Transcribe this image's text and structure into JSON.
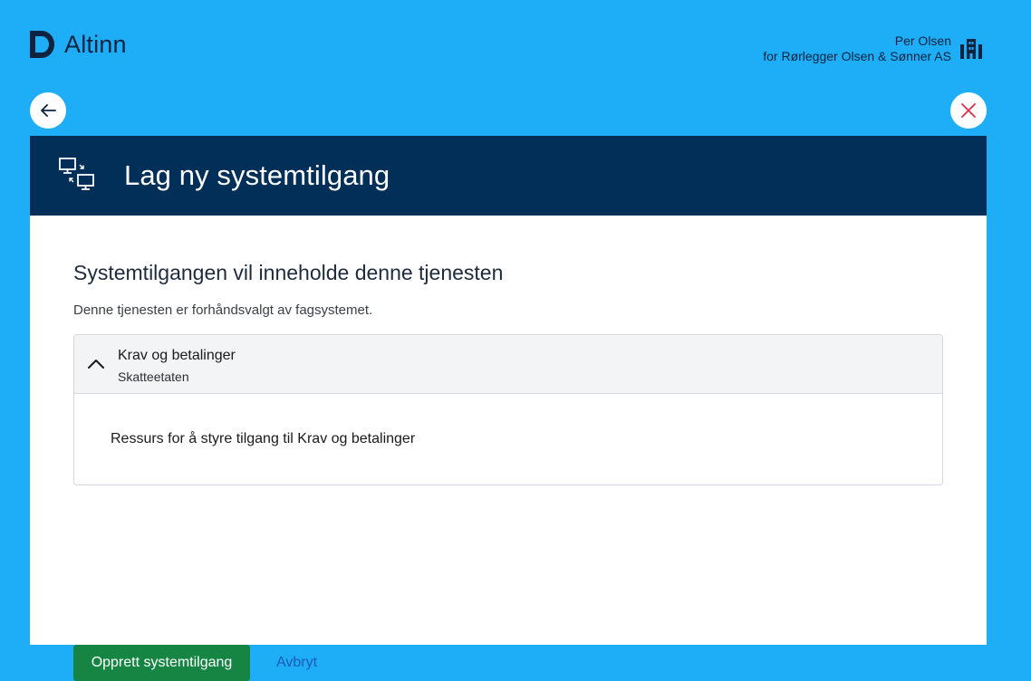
{
  "app": {
    "name": "Altinn"
  },
  "account": {
    "user_name": "Per Olsen",
    "on_behalf": "for Rørlegger Olsen & Sønner AS",
    "icon": "building-icon"
  },
  "nav": {
    "back_icon": "arrow-left-icon",
    "close_icon": "close-icon"
  },
  "header": {
    "title": "Lag ny systemtilgang",
    "icon": "system-access-icon"
  },
  "main": {
    "section_title": "Systemtilgangen vil inneholde denne tjenesten",
    "section_subtitle": "Denne tjenesten er forhåndsvalgt av fagsystemet.",
    "service": {
      "title": "Krav og betalinger",
      "owner": "Skatteetaten",
      "description": "Ressurs for å styre tilgang til Krav og betalinger",
      "expanded": true
    }
  },
  "actions": {
    "confirm_label": "Opprett systemtilgang",
    "cancel_label": "Avbryt"
  },
  "colors": {
    "background": "#1eadf7",
    "header": "#022f58",
    "primary": "#168544",
    "link": "#1d5bb5",
    "close": "#e02e49"
  }
}
